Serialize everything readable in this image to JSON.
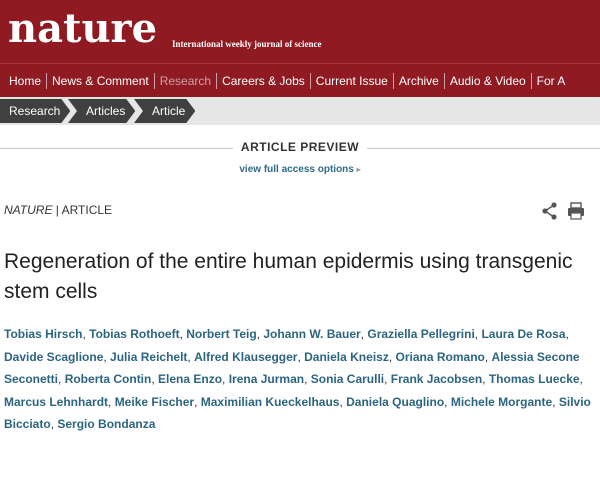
{
  "masthead": {
    "logo": "nature",
    "tagline": "International weekly journal of science",
    "background": "#8f1a22"
  },
  "nav": {
    "items": [
      {
        "label": "Home",
        "active": false
      },
      {
        "label": "News & Comment",
        "active": false
      },
      {
        "label": "Research",
        "active": true
      },
      {
        "label": "Careers & Jobs",
        "active": false
      },
      {
        "label": "Current Issue",
        "active": false
      },
      {
        "label": "Archive",
        "active": false
      },
      {
        "label": "Audio & Video",
        "active": false
      },
      {
        "label": "For A",
        "active": false
      }
    ]
  },
  "breadcrumb": [
    "Research",
    "Articles",
    "Article"
  ],
  "preview": {
    "heading": "ARTICLE PREVIEW",
    "access_link": "view full access options",
    "access_arrow": "▸"
  },
  "article": {
    "journal": "NATURE",
    "separator": " | ",
    "type": "ARTICLE",
    "title": "Regeneration of the entire human epidermis using transgenic stem cells",
    "authors": [
      "Tobias Hirsch",
      "Tobias Rothoeft",
      "Norbert Teig",
      "Johann W. Bauer",
      "Graziella Pellegrini",
      "Laura De Rosa",
      "Davide Scaglione",
      "Julia Reichelt",
      "Alfred Klausegger",
      "Daniela Kneisz",
      "Oriana Romano",
      "Alessia Secone Seconetti",
      "Roberta Contin",
      "Elena Enzo",
      "Irena Jurman",
      "Sonia Carulli",
      "Frank Jacobsen",
      "Thomas Luecke",
      "Marcus Lehnhardt",
      "Meike Fischer",
      "Maximilian Kueckelhaus",
      "Daniela Quaglino",
      "Michele Morgante",
      "Silvio Bicciato",
      "Sergio Bondanza"
    ]
  },
  "tools": {
    "share_icon": "share-icon",
    "print_icon": "print-icon"
  }
}
